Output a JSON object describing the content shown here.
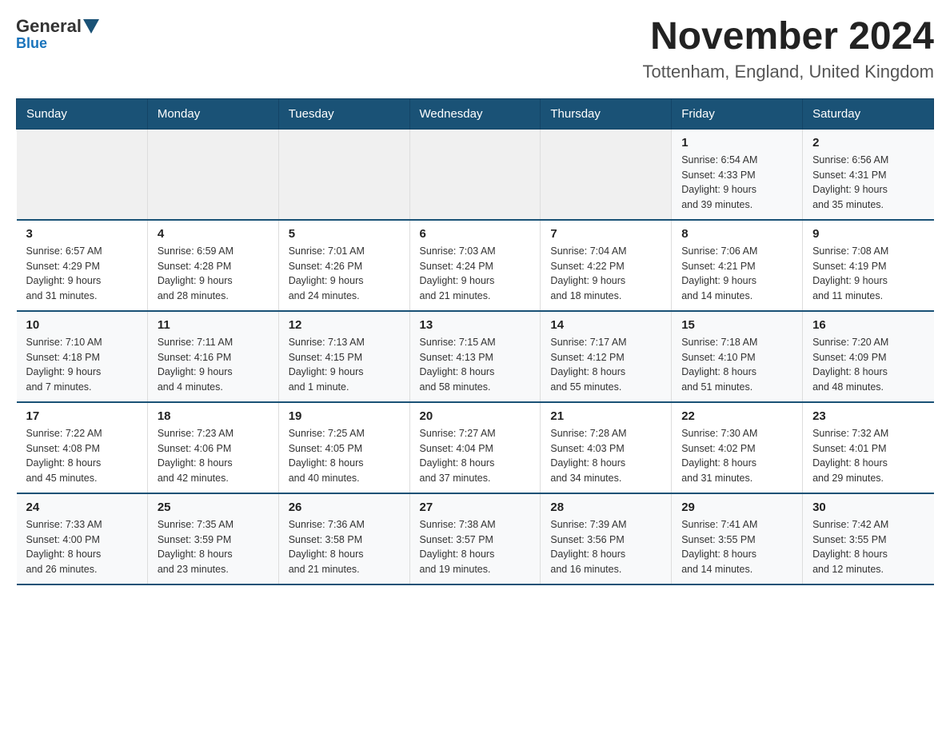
{
  "header": {
    "logo": {
      "general": "General",
      "blue": "Blue"
    },
    "title": "November 2024",
    "subtitle": "Tottenham, England, United Kingdom"
  },
  "calendar": {
    "days_of_week": [
      "Sunday",
      "Monday",
      "Tuesday",
      "Wednesday",
      "Thursday",
      "Friday",
      "Saturday"
    ],
    "weeks": [
      {
        "days": [
          {
            "number": "",
            "info": ""
          },
          {
            "number": "",
            "info": ""
          },
          {
            "number": "",
            "info": ""
          },
          {
            "number": "",
            "info": ""
          },
          {
            "number": "",
            "info": ""
          },
          {
            "number": "1",
            "info": "Sunrise: 6:54 AM\nSunset: 4:33 PM\nDaylight: 9 hours\nand 39 minutes."
          },
          {
            "number": "2",
            "info": "Sunrise: 6:56 AM\nSunset: 4:31 PM\nDaylight: 9 hours\nand 35 minutes."
          }
        ]
      },
      {
        "days": [
          {
            "number": "3",
            "info": "Sunrise: 6:57 AM\nSunset: 4:29 PM\nDaylight: 9 hours\nand 31 minutes."
          },
          {
            "number": "4",
            "info": "Sunrise: 6:59 AM\nSunset: 4:28 PM\nDaylight: 9 hours\nand 28 minutes."
          },
          {
            "number": "5",
            "info": "Sunrise: 7:01 AM\nSunset: 4:26 PM\nDaylight: 9 hours\nand 24 minutes."
          },
          {
            "number": "6",
            "info": "Sunrise: 7:03 AM\nSunset: 4:24 PM\nDaylight: 9 hours\nand 21 minutes."
          },
          {
            "number": "7",
            "info": "Sunrise: 7:04 AM\nSunset: 4:22 PM\nDaylight: 9 hours\nand 18 minutes."
          },
          {
            "number": "8",
            "info": "Sunrise: 7:06 AM\nSunset: 4:21 PM\nDaylight: 9 hours\nand 14 minutes."
          },
          {
            "number": "9",
            "info": "Sunrise: 7:08 AM\nSunset: 4:19 PM\nDaylight: 9 hours\nand 11 minutes."
          }
        ]
      },
      {
        "days": [
          {
            "number": "10",
            "info": "Sunrise: 7:10 AM\nSunset: 4:18 PM\nDaylight: 9 hours\nand 7 minutes."
          },
          {
            "number": "11",
            "info": "Sunrise: 7:11 AM\nSunset: 4:16 PM\nDaylight: 9 hours\nand 4 minutes."
          },
          {
            "number": "12",
            "info": "Sunrise: 7:13 AM\nSunset: 4:15 PM\nDaylight: 9 hours\nand 1 minute."
          },
          {
            "number": "13",
            "info": "Sunrise: 7:15 AM\nSunset: 4:13 PM\nDaylight: 8 hours\nand 58 minutes."
          },
          {
            "number": "14",
            "info": "Sunrise: 7:17 AM\nSunset: 4:12 PM\nDaylight: 8 hours\nand 55 minutes."
          },
          {
            "number": "15",
            "info": "Sunrise: 7:18 AM\nSunset: 4:10 PM\nDaylight: 8 hours\nand 51 minutes."
          },
          {
            "number": "16",
            "info": "Sunrise: 7:20 AM\nSunset: 4:09 PM\nDaylight: 8 hours\nand 48 minutes."
          }
        ]
      },
      {
        "days": [
          {
            "number": "17",
            "info": "Sunrise: 7:22 AM\nSunset: 4:08 PM\nDaylight: 8 hours\nand 45 minutes."
          },
          {
            "number": "18",
            "info": "Sunrise: 7:23 AM\nSunset: 4:06 PM\nDaylight: 8 hours\nand 42 minutes."
          },
          {
            "number": "19",
            "info": "Sunrise: 7:25 AM\nSunset: 4:05 PM\nDaylight: 8 hours\nand 40 minutes."
          },
          {
            "number": "20",
            "info": "Sunrise: 7:27 AM\nSunset: 4:04 PM\nDaylight: 8 hours\nand 37 minutes."
          },
          {
            "number": "21",
            "info": "Sunrise: 7:28 AM\nSunset: 4:03 PM\nDaylight: 8 hours\nand 34 minutes."
          },
          {
            "number": "22",
            "info": "Sunrise: 7:30 AM\nSunset: 4:02 PM\nDaylight: 8 hours\nand 31 minutes."
          },
          {
            "number": "23",
            "info": "Sunrise: 7:32 AM\nSunset: 4:01 PM\nDaylight: 8 hours\nand 29 minutes."
          }
        ]
      },
      {
        "days": [
          {
            "number": "24",
            "info": "Sunrise: 7:33 AM\nSunset: 4:00 PM\nDaylight: 8 hours\nand 26 minutes."
          },
          {
            "number": "25",
            "info": "Sunrise: 7:35 AM\nSunset: 3:59 PM\nDaylight: 8 hours\nand 23 minutes."
          },
          {
            "number": "26",
            "info": "Sunrise: 7:36 AM\nSunset: 3:58 PM\nDaylight: 8 hours\nand 21 minutes."
          },
          {
            "number": "27",
            "info": "Sunrise: 7:38 AM\nSunset: 3:57 PM\nDaylight: 8 hours\nand 19 minutes."
          },
          {
            "number": "28",
            "info": "Sunrise: 7:39 AM\nSunset: 3:56 PM\nDaylight: 8 hours\nand 16 minutes."
          },
          {
            "number": "29",
            "info": "Sunrise: 7:41 AM\nSunset: 3:55 PM\nDaylight: 8 hours\nand 14 minutes."
          },
          {
            "number": "30",
            "info": "Sunrise: 7:42 AM\nSunset: 3:55 PM\nDaylight: 8 hours\nand 12 minutes."
          }
        ]
      }
    ]
  }
}
